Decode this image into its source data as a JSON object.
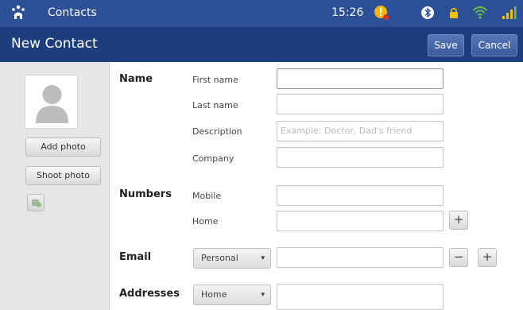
{
  "status_bar": {
    "app_name": "Contacts",
    "time": "15:26",
    "icons": [
      "app-icon",
      "alert-icon",
      "bluetooth-icon",
      "lock-icon",
      "wifi-icon",
      "signal-icon"
    ]
  },
  "action_bar": {
    "title": "New Contact",
    "save_label": "Save",
    "cancel_label": "Cancel"
  },
  "photo": {
    "add_label": "Add photo",
    "shoot_label": "Shoot photo"
  },
  "name_section": {
    "label": "Name",
    "fields": [
      {
        "label": "First name",
        "value": "",
        "placeholder": ""
      },
      {
        "label": "Last name",
        "value": "",
        "placeholder": ""
      },
      {
        "label": "Description",
        "value": "",
        "placeholder": "Example: Doctor, Dad's friend"
      },
      {
        "label": "Company",
        "value": "",
        "placeholder": ""
      }
    ]
  },
  "numbers_section": {
    "label": "Numbers",
    "fields": [
      {
        "label": "Mobile",
        "value": ""
      },
      {
        "label": "Home",
        "value": ""
      }
    ],
    "add_symbol": "+"
  },
  "email_section": {
    "label": "Email",
    "type": "Personal",
    "value": "",
    "remove_symbol": "−",
    "add_symbol": "+"
  },
  "addresses_section": {
    "label": "Addresses",
    "type": "Home",
    "value": ""
  },
  "colors": {
    "status_bar": "#2c4f96",
    "action_bar": "#1e3d7d",
    "alert": "#f4b400",
    "wifi": "#6cc04a",
    "signal": "#f2c200"
  }
}
